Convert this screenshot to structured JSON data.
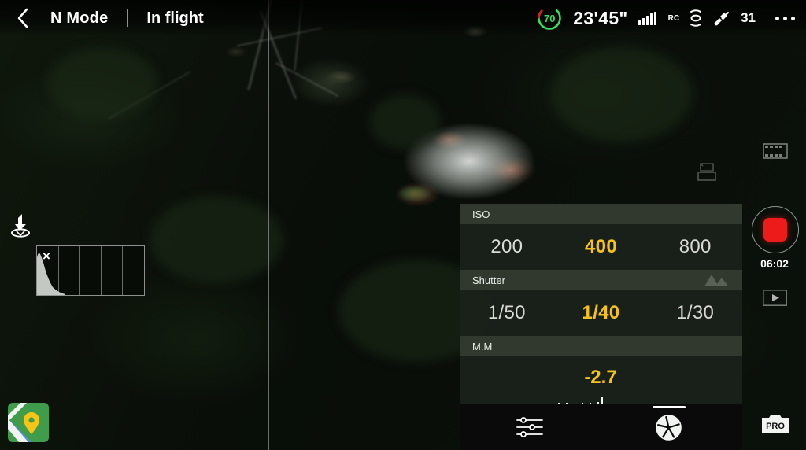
{
  "header": {
    "back_icon": "back-chevron-icon",
    "flight_mode": "N Mode",
    "flight_status": "In flight",
    "battery": {
      "percent": "70",
      "icon": "battery-ring-icon",
      "color": "#3ddc5e",
      "warning_color": "#d32020"
    },
    "flight_time": "23'45\"",
    "signal": {
      "icon": "signal-bars-icon",
      "label": "RC",
      "bars": 5
    },
    "vision_icon": "vision-sensor-icon",
    "satellites": {
      "icon": "satellite-icon",
      "count": "31"
    },
    "more_icon": "more-options-icon"
  },
  "overlays": {
    "grid_lines": "rule-of-thirds-grid",
    "landing_icon": "auto-landing-icon",
    "histogram": {
      "close_label": "×",
      "name": "histogram-widget",
      "segments": 5
    },
    "map_thumbnail": "map-thumbnail"
  },
  "right_rail": {
    "filmstrip_icon": "filmstrip-icon",
    "storage_icon": "storage-card-icon",
    "record_button": {
      "icon": "record-stop-icon",
      "color": "#ee1b1b"
    },
    "record_time": "06:02",
    "playback_icon": "playback-icon",
    "pro_icon": "pro-camera-icon",
    "pro_label": "PRO"
  },
  "camera_panel": {
    "iso": {
      "label": "ISO",
      "options": [
        "200",
        "400",
        "800"
      ],
      "selected": "400"
    },
    "shutter": {
      "label": "Shutter",
      "options": [
        "1/50",
        "1/40",
        "1/30"
      ],
      "selected": "1/40",
      "icon": "mountain-focus-icon"
    },
    "exposure": {
      "label": "M.M",
      "value": "-2.7"
    },
    "highlight_color": "#f4c21a"
  },
  "bottom_bar": {
    "settings_icon": "sliders-settings-icon",
    "shutter_icon": "aperture-shutter-icon"
  }
}
